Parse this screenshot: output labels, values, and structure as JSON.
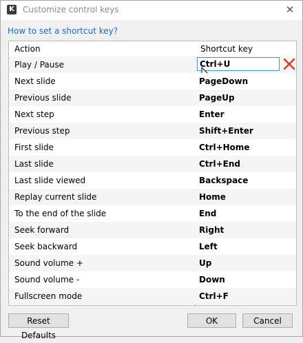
{
  "window": {
    "title": "Customize control keys",
    "app_icon_letter": "K",
    "close_glyph": "✕"
  },
  "help_link": "How to set a shortcut key?",
  "table": {
    "headers": {
      "action": "Action",
      "shortcut": "Shortcut key"
    },
    "rows": [
      {
        "action": "Play / Pause",
        "key": "Ctrl+U"
      },
      {
        "action": "Next slide",
        "key": "PageDown"
      },
      {
        "action": "Previous slide",
        "key": "PageUp"
      },
      {
        "action": "Next step",
        "key": "Enter"
      },
      {
        "action": "Previous step",
        "key": "Shift+Enter"
      },
      {
        "action": "First slide",
        "key": "Ctrl+Home"
      },
      {
        "action": "Last slide",
        "key": "Ctrl+End"
      },
      {
        "action": "Last slide viewed",
        "key": "Backspace"
      },
      {
        "action": "Replay current slide",
        "key": "Home"
      },
      {
        "action": "To the end of the slide",
        "key": "End"
      },
      {
        "action": "Seek forward",
        "key": "Right"
      },
      {
        "action": "Seek backward",
        "key": "Left"
      },
      {
        "action": "Sound volume +",
        "key": "Up"
      },
      {
        "action": "Sound volume -",
        "key": "Down"
      },
      {
        "action": "Fullscreen mode",
        "key": "Ctrl+F"
      }
    ]
  },
  "buttons": {
    "reset": "Reset Defaults",
    "ok": "OK",
    "cancel": "Cancel"
  },
  "icons": {
    "clear": "clear-shortcut-icon",
    "cursor": "mouse-cursor-icon"
  },
  "colors": {
    "link": "#1e6cb8",
    "clear_icon": "#d9381e",
    "edit_border": "#4a90d9"
  }
}
